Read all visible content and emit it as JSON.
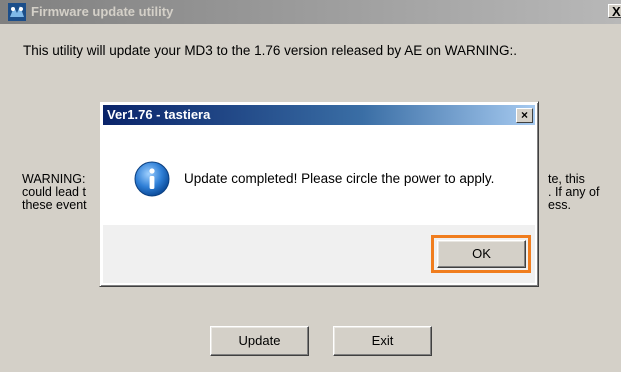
{
  "main_window": {
    "title": "Firmware update utility",
    "close_glyph": "X",
    "intro": "This utility will update your MD3 to the 1.76 version released by AE on WARNING:.",
    "warning_left": "WARNING:\ncould lead t\nthese event",
    "warning_right": "te, this\n. If any of\ness.",
    "buttons": {
      "update": "Update",
      "exit": "Exit"
    },
    "icon": "app-update-icon"
  },
  "dialog": {
    "title": "Ver1.76 - tastiera",
    "close_glyph": "×",
    "message": "Update completed! Please circle the power to apply.",
    "icon": "info-icon",
    "ok_label": "OK",
    "highlight_color": "#f07d1e"
  },
  "colors": {
    "inactive_title": "#808080",
    "active_title": "#0a246a",
    "face": "#d4d0c8"
  }
}
